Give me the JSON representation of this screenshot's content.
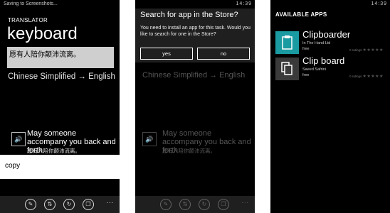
{
  "screen1": {
    "status_left": "Saving to Screenshots...",
    "label": "TRANSLATOR",
    "title": "keyboard",
    "input_text": "愿有人陪你颠沛流离。",
    "language_pair": "Chinese Simplified → English",
    "translation": "May someone accompany you back and forth.",
    "source_text": "愿有人陪你颠沛流离。",
    "copy_label": "copy"
  },
  "screen2": {
    "time": "14:39",
    "dialog_title": "Search for app in the Store?",
    "dialog_text": "You need to install an app for this task. Would you like to search for one in the Store?",
    "yes_label": "yes",
    "no_label": "no",
    "language_pair": "Chinese Simplified → English",
    "translation": "May someone accompany you back and forth.",
    "source_text": "愿有人陪你颠沛流离。"
  },
  "screen3": {
    "time": "14:39",
    "header": "AVAILABLE APPS",
    "apps": [
      {
        "name": "Clipboarder",
        "publisher": "In The Hand Ltd",
        "price": "free",
        "ratings": "0 ratings",
        "stars": "★★★★★",
        "tile_color": "#1a9ba1",
        "icon": "clipboard-icon"
      },
      {
        "name": "Clip board",
        "publisher": "Saeed Safrini",
        "price": "free",
        "ratings": "0 ratings",
        "stars": "★★★★★",
        "tile_color": "#3a3a3a",
        "icon": "copy-icon"
      }
    ]
  },
  "appbar": {
    "icons": [
      "pin-icon",
      "swap-icon",
      "refresh-icon",
      "copy-icon"
    ],
    "more": "..."
  }
}
